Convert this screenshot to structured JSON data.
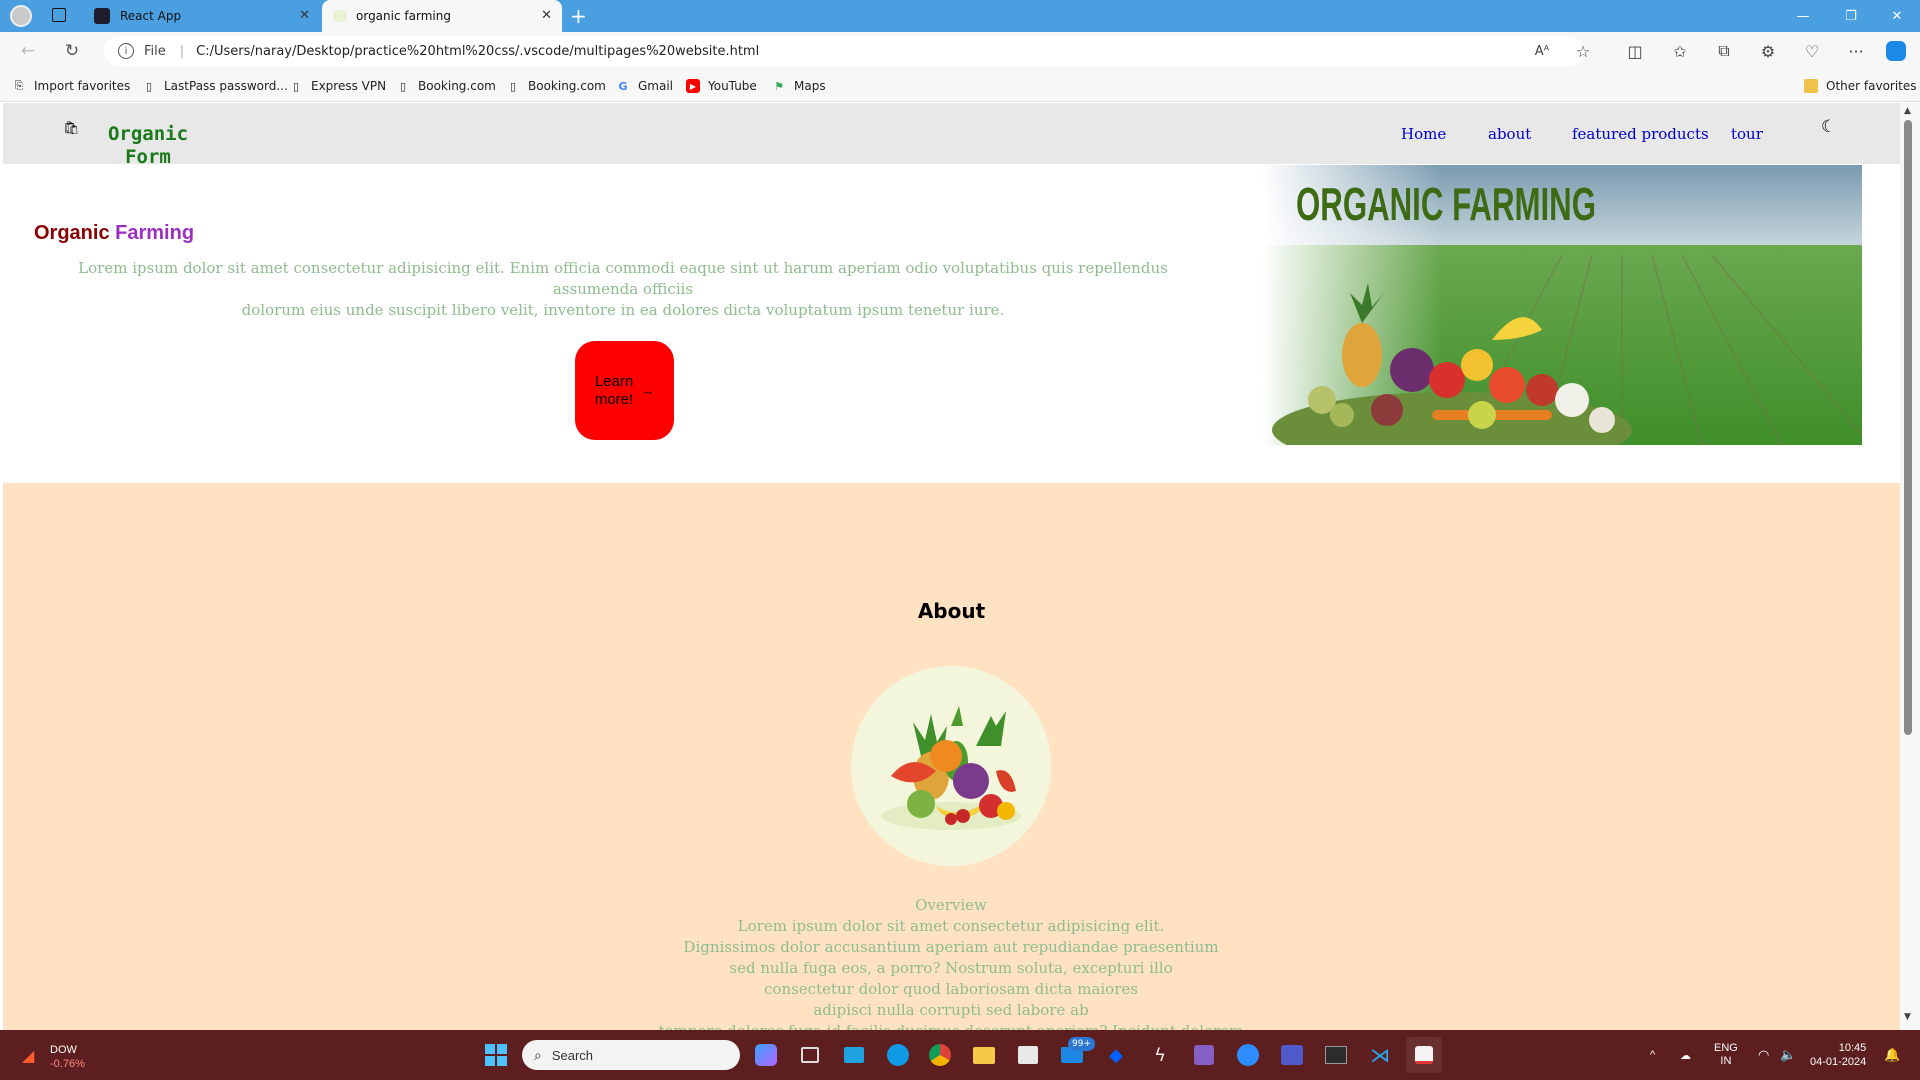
{
  "browser": {
    "tabs": [
      {
        "title": "React App",
        "active": false
      },
      {
        "title": "organic farming",
        "active": true
      }
    ],
    "url_scheme_label": "File",
    "url": "C:/Users/naray/Desktop/practice%20html%20css/.vscode/multipages%20website.html",
    "favorites": [
      {
        "label": "Import favorites",
        "icon": "import-icon"
      },
      {
        "label": "LastPass password...",
        "icon": "page-icon"
      },
      {
        "label": "Express VPN",
        "icon": "page-icon"
      },
      {
        "label": "Booking.com",
        "icon": "page-icon"
      },
      {
        "label": "Booking.com",
        "icon": "page-icon"
      },
      {
        "label": "Gmail",
        "icon": "google-icon"
      },
      {
        "label": "YouTube",
        "icon": "youtube-icon"
      },
      {
        "label": "Maps",
        "icon": "maps-icon"
      }
    ],
    "other_favorites": "Other favorites"
  },
  "site": {
    "logo": {
      "line1": "Organic",
      "line2": "Form"
    },
    "nav": [
      "Home",
      "about",
      "featured products",
      "tour"
    ],
    "hero": {
      "title_word1": "Organic",
      "title_word2": "Farming",
      "text_line1": "Lorem ipsum dolor sit amet consectetur adipisicing elit. Enim officia commodi eaque sint ut harum aperiam odio voluptatibus quis repellendus assumenda officiis",
      "text_line2": "dolorum eius unde suscipit libero velit, inventore in ea dolores dicta voluptatum ipsum tenetur iure.",
      "button_line1": "Learn",
      "button_line2": "more!",
      "banner_text": "ORGANIC FARMING"
    },
    "about": {
      "title": "About",
      "lines": [
        "Overview",
        "Lorem ipsum dolor sit amet consectetur adipisicing elit.",
        "Dignissimos dolor accusantium aperiam aut repudiandae praesentium",
        "sed nulla fuga eos, a porro? Nostrum soluta, excepturi illo",
        "consectetur dolor quod laboriosam dicta maiores",
        "adipisci nulla corrupti sed labore ab",
        "tempore dolores fuga id facilis ducimus deserunt aperiam? Incidunt dolorem"
      ]
    }
  },
  "taskbar": {
    "stock_name": "DOW",
    "stock_change": "-0.76%",
    "search_placeholder": "Search",
    "badge": "99+",
    "lang_line1": "ENG",
    "lang_line2": "IN",
    "time": "10:45",
    "date": "04-01-2024"
  },
  "colors": {
    "titlebar": "#4a9fe0",
    "accent_red": "#ff0000",
    "about_bg": "#ffe2c2",
    "hero_text": "#8fbc8f",
    "logo": "#1a7a1a"
  }
}
